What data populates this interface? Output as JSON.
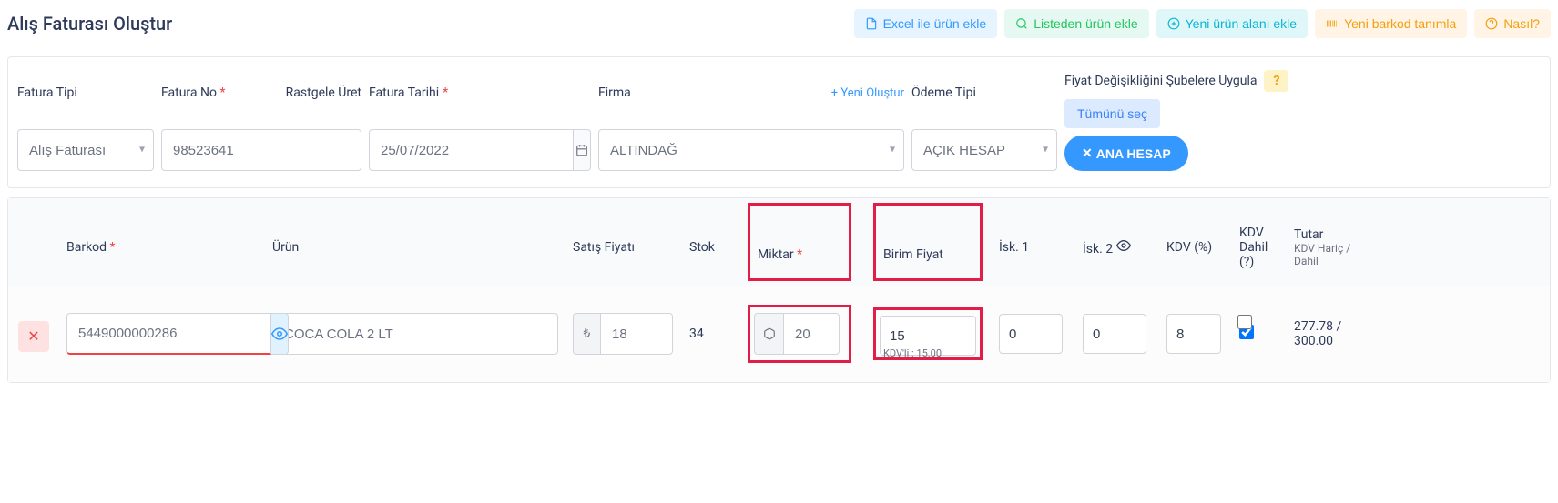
{
  "page": {
    "title": "Alış Faturası Oluştur"
  },
  "actions": {
    "excel": "Excel ile ürün ekle",
    "list": "Listeden ürün ekle",
    "newField": "Yeni ürün alanı ekle",
    "barcode": "Yeni barkod tanımla",
    "how": "Nasıl?"
  },
  "form": {
    "invoiceType": {
      "label": "Fatura Tipi",
      "value": "Alış Faturası"
    },
    "invoiceNo": {
      "label": "Fatura No",
      "value": "98523641",
      "randomLabel": "Rastgele Üret"
    },
    "invoiceDate": {
      "label": "Fatura Tarihi",
      "value": "25/07/2022"
    },
    "firm": {
      "label": "Firma",
      "value": "ALTINDAĞ",
      "newLink": "+ Yeni Oluştur"
    },
    "paymentType": {
      "label": "Ödeme Tipi",
      "value": "AÇIK HESAP"
    },
    "branches": {
      "label": "Fiyat Değişikliğini Şubelere Uygula",
      "help": "?",
      "selectAll": "Tümünü seç",
      "main": "ANA HESAP"
    }
  },
  "table": {
    "headers": {
      "barkod": "Barkod",
      "urun": "Ürün",
      "satisFiyati": "Satış Fiyatı",
      "stok": "Stok",
      "miktar": "Miktar",
      "birimFiyat": "Birim Fiyat",
      "isk1": "İsk. 1",
      "isk2": "İsk. 2",
      "kdv": "KDV (%)",
      "kdvDahil": "KDV Dahil (?)",
      "tutar": "Tutar",
      "tutarSub": "KDV Hariç / Dahil"
    },
    "rows": [
      {
        "barkod": "5449000000286",
        "urun": "COCA COLA 2 LT",
        "satisFiyati": "18",
        "stok": "34",
        "miktar": "20",
        "birimFiyat": "15",
        "birimFiyatKdvli": "KDV'li : 15.00",
        "isk1": "0",
        "isk2": "0",
        "kdv": "8",
        "kdvDahil": true,
        "tutar": "277.78 / 300.00"
      }
    ]
  }
}
